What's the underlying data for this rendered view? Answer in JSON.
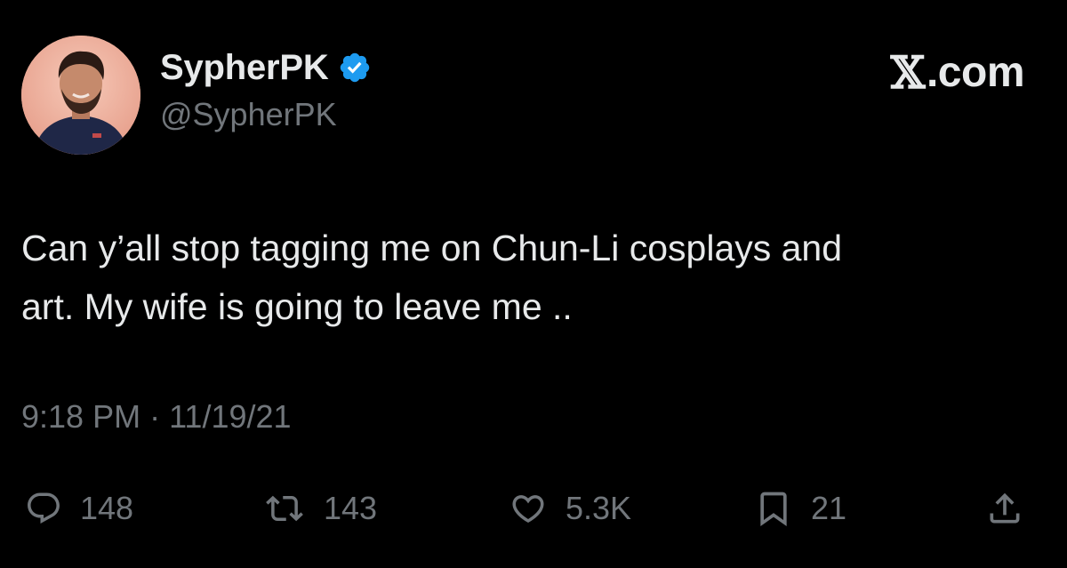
{
  "author": {
    "display_name": "SypherPK",
    "handle": "@SypherPK",
    "verified": true
  },
  "brand": {
    "mark": "𝕏",
    "suffix": ".com"
  },
  "tweet": {
    "text": "Can y’all stop tagging me on Chun-Li cosplays and\nart. My wife is going to leave me ..",
    "time": "9:18 PM",
    "separator": "·",
    "date": "11/19/21"
  },
  "actions": {
    "reply_count": "148",
    "retweet_count": "143",
    "like_count": "5.3K",
    "bookmark_count": "21"
  },
  "icons": {
    "reply": "speech-bubble-icon",
    "retweet": "retweet-arrows-icon",
    "like": "heart-icon",
    "bookmark": "bookmark-icon",
    "share": "share-upload-icon",
    "verified": "verified-badge-icon"
  },
  "colors": {
    "background": "#000000",
    "primary_text": "#e7e9ea",
    "secondary_text": "#71767b",
    "verified_blue": "#1d9bf0"
  }
}
